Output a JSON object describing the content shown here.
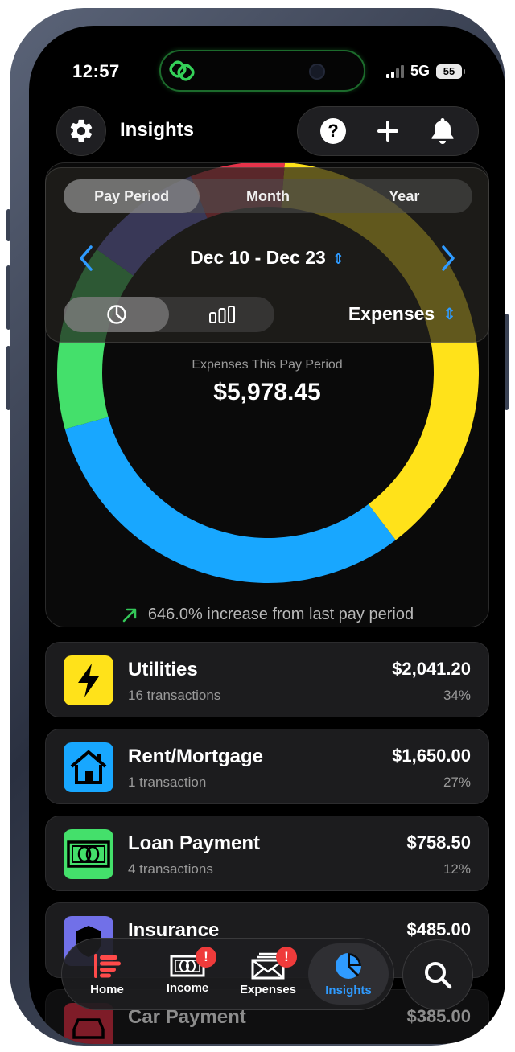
{
  "status_bar": {
    "time": "12:57",
    "network": "5G",
    "battery": "55"
  },
  "header": {
    "title": "Insights"
  },
  "period_tabs": [
    "Pay Period",
    "Month",
    "Year"
  ],
  "active_period": "Pay Period",
  "date_range": "Dec 10 - Dec 23",
  "type_selector": "Expenses",
  "chart_data": {
    "type": "pie",
    "donut": true,
    "categories": [
      "Utilities",
      "Rent/Mortgage",
      "Loan Payment",
      "Insurance",
      "Car Payment"
    ],
    "values": [
      2041.2,
      1650.0,
      758.5,
      485.0,
      385.0
    ],
    "colors": [
      "#FFE21A",
      "#18A7FF",
      "#44E06B",
      "#7170E8",
      "#E6334A"
    ],
    "center_label": "Expenses This Pay Period",
    "center_value": "$5,978.45"
  },
  "trend": {
    "text": "646.0% increase from last pay period",
    "color": "#34C759"
  },
  "categories": [
    {
      "name": "Utilities",
      "count": "16 transactions",
      "amount": "$2,041.20",
      "percent": "34%",
      "icon": "bolt-icon",
      "color": "#FFE21A"
    },
    {
      "name": "Rent/Mortgage",
      "count": "1 transaction",
      "amount": "$1,650.00",
      "percent": "27%",
      "icon": "house-icon",
      "color": "#18A7FF"
    },
    {
      "name": "Loan Payment",
      "count": "4 transactions",
      "amount": "$758.50",
      "percent": "12%",
      "icon": "banknote-icon",
      "color": "#44E06B"
    },
    {
      "name": "Insurance",
      "amount": "$485.00",
      "icon": "shield-icon",
      "color": "#7170E8"
    },
    {
      "name": "Car Payment",
      "amount": "$385.00",
      "icon": "car-icon",
      "color": "#E6334A"
    }
  ],
  "tabbar": {
    "tabs": [
      {
        "label": "Home",
        "icon": "home-bars-icon"
      },
      {
        "label": "Income",
        "icon": "cash-icon",
        "badge": "!"
      },
      {
        "label": "Expenses",
        "icon": "envelope-icon",
        "badge": "!"
      },
      {
        "label": "Insights",
        "icon": "pie-chart-icon",
        "active": true
      }
    ]
  },
  "colors": {
    "accent": "#2F9BFF",
    "badge": "#EF3B3B",
    "background": "#000000"
  }
}
